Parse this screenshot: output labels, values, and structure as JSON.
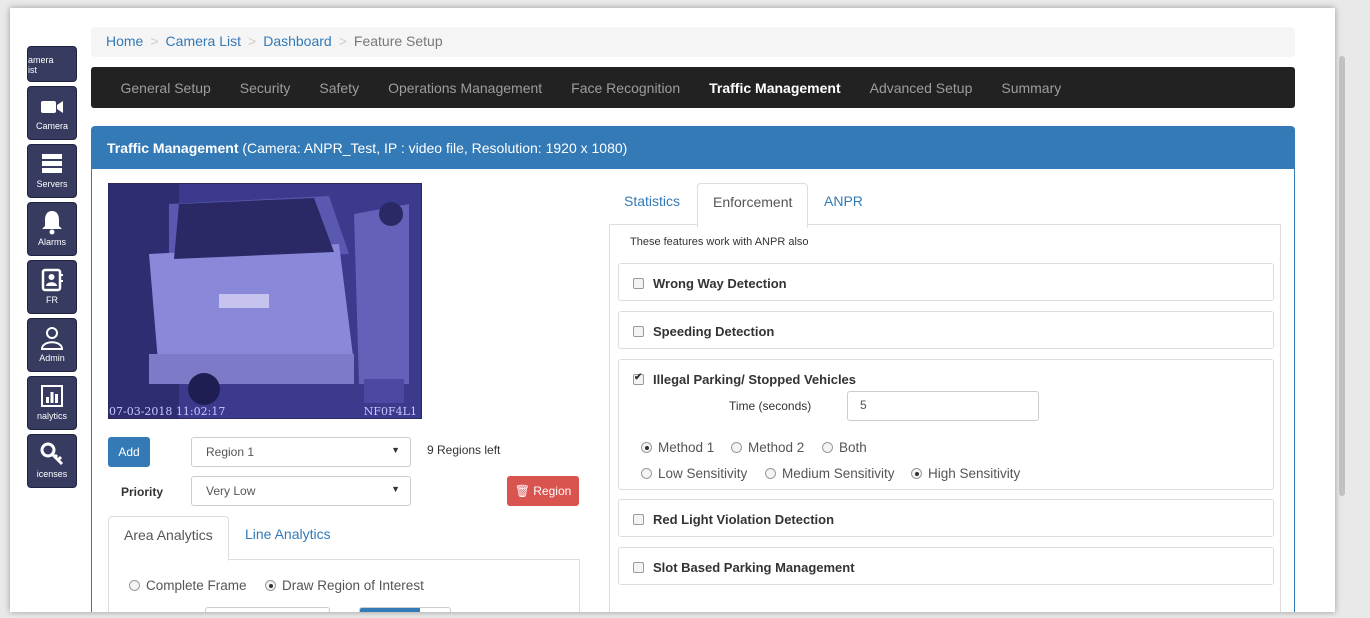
{
  "sidebar": {
    "items": [
      {
        "label": "Camera List",
        "icon": "camera-list-icon"
      },
      {
        "label": "Camera",
        "icon": "video-camera-icon"
      },
      {
        "label": "Servers",
        "icon": "server-icon"
      },
      {
        "label": "Alarms",
        "icon": "bell-icon"
      },
      {
        "label": "FR",
        "icon": "contact-card-icon"
      },
      {
        "label": "Admin",
        "icon": "user-icon"
      },
      {
        "label": "Analytics",
        "icon": "bar-chart-icon"
      },
      {
        "label": "Licenses",
        "icon": "key-icon"
      }
    ],
    "visible_labels": [
      "amera\nist",
      "Camera",
      "Servers",
      "Alarms",
      "FR",
      "Admin",
      "nalytics",
      "icenses"
    ]
  },
  "breadcrumb": {
    "home": "Home",
    "camera_list": "Camera List",
    "dashboard": "Dashboard",
    "current": "Feature Setup",
    "separator": ">"
  },
  "nav": {
    "items": [
      "General Setup",
      "Security",
      "Safety",
      "Operations Management",
      "Face Recognition",
      "Traffic Management",
      "Advanced Setup",
      "Summary"
    ],
    "active": "Traffic Management"
  },
  "panel": {
    "title_bold": "Traffic Management",
    "title_rest": " (Camera: ANPR_Test, IP : video file, Resolution: 1920 x 1080)"
  },
  "video": {
    "timestamp": "07-03-2018 11:02:17",
    "plate_overlay": "NF0F4L1"
  },
  "controls": {
    "add_label": "Add",
    "region_select": "Region 1",
    "regions_left": "9 Regions left",
    "priority_label": "Priority",
    "priority_select": "Very Low",
    "delete_region_label": "Region"
  },
  "left_tabs": {
    "area": "Area Analytics",
    "line": "Line Analytics",
    "complete_frame": "Complete Frame",
    "draw_roi": "Draw Region of Interest"
  },
  "right_tabs": {
    "statistics": "Statistics",
    "enforcement": "Enforcement",
    "anpr": "ANPR"
  },
  "enforcement": {
    "note": "These features work with ANPR also",
    "wrong_way": "Wrong Way Detection",
    "speeding": "Speeding Detection",
    "illegal_parking": "Illegal Parking/ Stopped Vehicles",
    "time_label": "Time (seconds)",
    "time_value": "5",
    "method1": "Method 1",
    "method2": "Method 2",
    "both": "Both",
    "low": "Low Sensitivity",
    "medium": "Medium Sensitivity",
    "high": "High Sensitivity",
    "red_light": "Red Light Violation Detection",
    "slot_parking": "Slot Based Parking Management"
  },
  "colors": {
    "primary": "#337ab7",
    "danger": "#d9534f",
    "navbar": "#222222",
    "sidebar": "#363b5f"
  }
}
